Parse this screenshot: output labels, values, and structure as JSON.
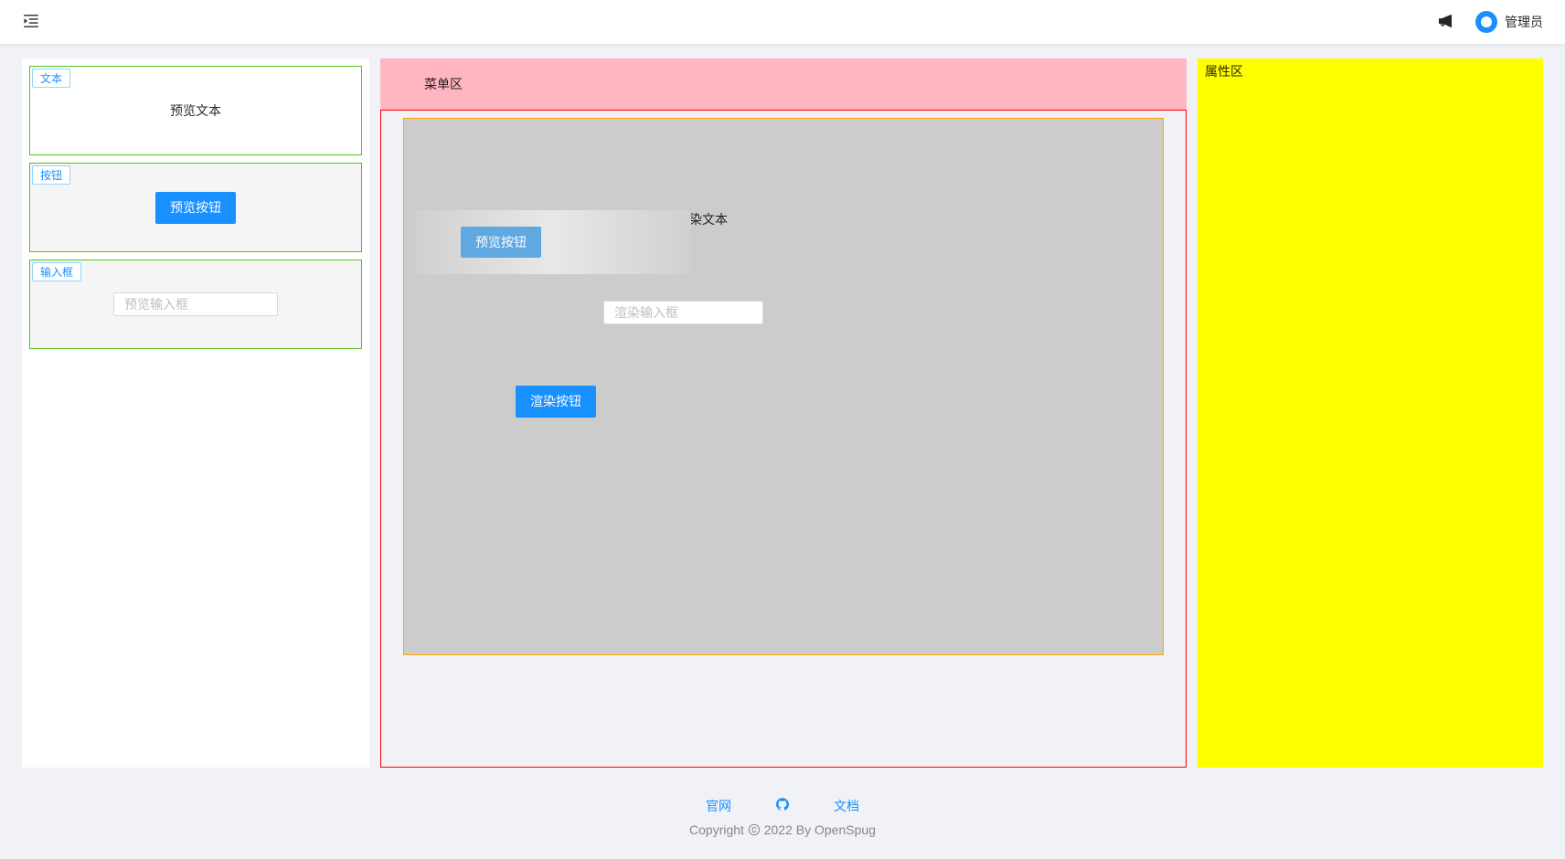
{
  "header": {
    "username": "管理员"
  },
  "sidebar": {
    "components": [
      {
        "tag": "文本",
        "preview_text": "预览文本"
      },
      {
        "tag": "按钮",
        "preview_button": "预览按钮"
      },
      {
        "tag": "输入框",
        "preview_input_placeholder": "预览输入框"
      }
    ]
  },
  "center": {
    "menu_area_label": "菜单区",
    "canvas": {
      "render_text": "渲染文本",
      "preview_button": "预览按钮",
      "render_input_placeholder": "渲染输入框",
      "render_button": "渲染按钮"
    }
  },
  "props": {
    "label": "属性区"
  },
  "footer": {
    "links": {
      "website": "官网",
      "docs": "文档"
    },
    "copyright_prefix": "Copyright ",
    "copyright_suffix": " 2022 By OpenSpug"
  }
}
